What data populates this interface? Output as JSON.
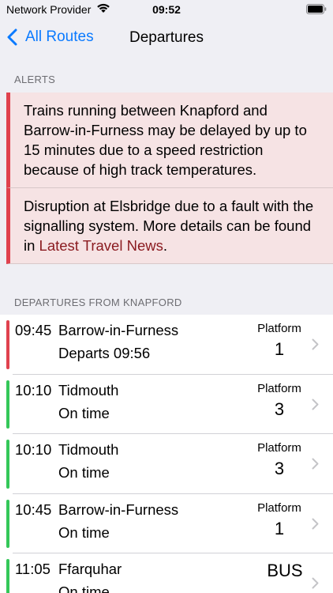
{
  "status_bar": {
    "carrier": "Network Provider",
    "time": "09:52"
  },
  "nav": {
    "back_label": "All Routes",
    "title": "Departures"
  },
  "alerts": {
    "header": "ALERTS",
    "items": [
      {
        "text": "Trains running between Knapford and Barrow-in-Furness may be delayed by up to 15 minutes due to a speed restriction because of high track temperatures."
      },
      {
        "text_before": "Disruption at Elsbridge due to a fault with the signalling system. More details can be found in ",
        "link": "Latest Travel News",
        "text_after": "."
      }
    ]
  },
  "departures": {
    "header": "DEPARTURES FROM KNAPFORD",
    "rows": [
      {
        "time": "09:45",
        "destination": "Barrow-in-Furness",
        "status": "Departs 09:56",
        "platform_label": "Platform",
        "platform": "1",
        "bar_color": "#e0424e"
      },
      {
        "time": "10:10",
        "destination": "Tidmouth",
        "status": "On time",
        "platform_label": "Platform",
        "platform": "3",
        "bar_color": "#34c759"
      },
      {
        "time": "10:10",
        "destination": "Tidmouth",
        "status": "On time",
        "platform_label": "Platform",
        "platform": "3",
        "bar_color": "#34c759"
      },
      {
        "time": "10:45",
        "destination": "Barrow-in-Furness",
        "status": "On time",
        "platform_label": "Platform",
        "platform": "1",
        "bar_color": "#34c759"
      },
      {
        "time": "11:05",
        "destination": "Ffarquhar",
        "status": "On time",
        "platform_label": "",
        "platform": "BUS",
        "bar_color": "#34c759"
      }
    ]
  },
  "colors": {
    "accent": "#0a7aff",
    "delay": "#e0424e",
    "on_time": "#34c759",
    "alert_bg": "#f6e3e4",
    "link": "#8a1a1f"
  }
}
